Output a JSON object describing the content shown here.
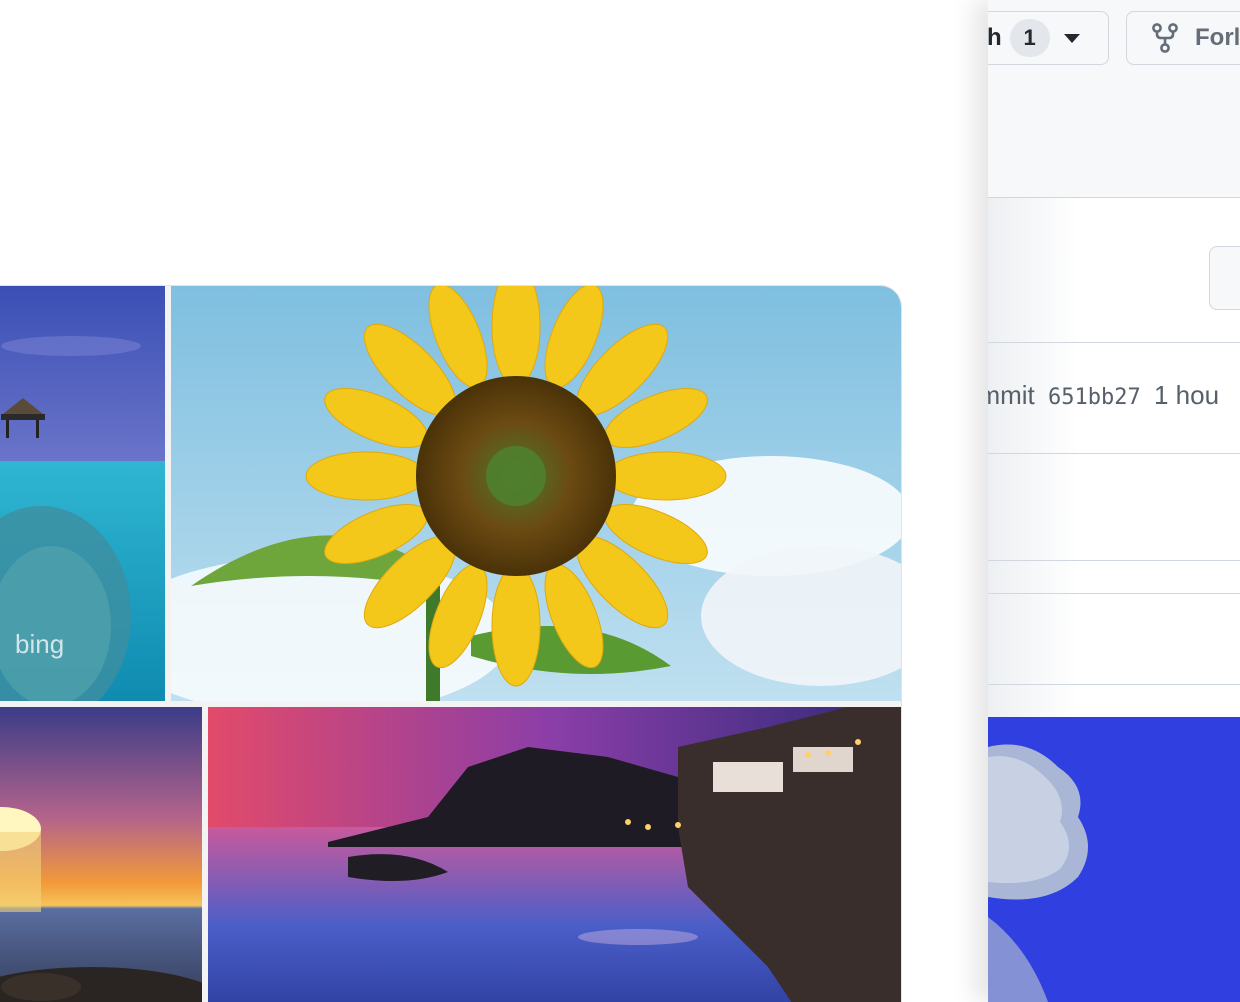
{
  "header": {
    "watch_label": "h",
    "watch_count": "1",
    "fork_label": "Forl"
  },
  "commit": {
    "prefix": "ommit",
    "sha": "651bb27",
    "time": "1 hou"
  },
  "gallery": {
    "watermark": "bing"
  }
}
